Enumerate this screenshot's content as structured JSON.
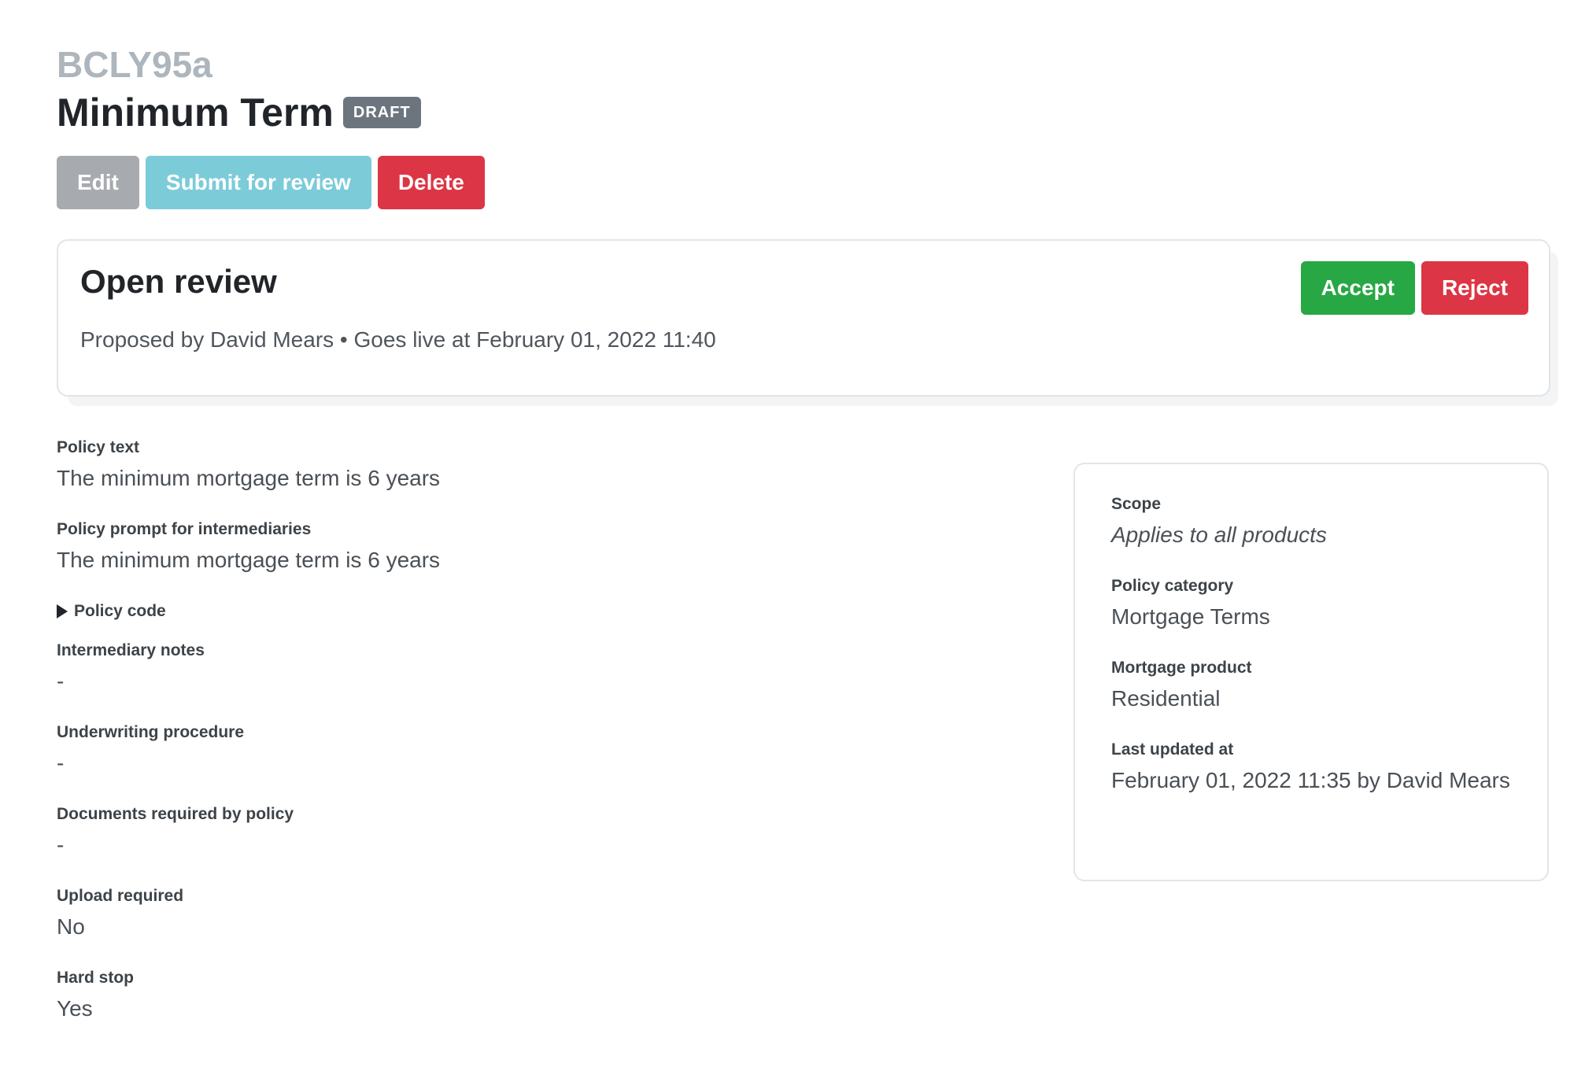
{
  "header": {
    "code": "BCLY95a",
    "title": "Minimum Term",
    "status_badge": "DRAFT"
  },
  "actions": {
    "edit": "Edit",
    "submit_for_review": "Submit for review",
    "delete": "Delete"
  },
  "review": {
    "title": "Open review",
    "meta": "Proposed by David Mears • Goes live at February 01, 2022 11:40",
    "accept": "Accept",
    "reject": "Reject"
  },
  "details": {
    "policy_text": {
      "label": "Policy text",
      "value": "The minimum mortgage term is 6 years"
    },
    "policy_prompt": {
      "label": "Policy prompt for intermediaries",
      "value": "The minimum mortgage term is 6 years"
    },
    "policy_code_summary": "Policy code",
    "intermediary_notes": {
      "label": "Intermediary notes",
      "value": "-"
    },
    "underwriting_procedure": {
      "label": "Underwriting procedure",
      "value": "-"
    },
    "documents_required": {
      "label": "Documents required by policy",
      "value": "-"
    },
    "upload_required": {
      "label": "Upload required",
      "value": "No"
    },
    "hard_stop": {
      "label": "Hard stop",
      "value": "Yes"
    }
  },
  "sidebar": {
    "scope": {
      "label": "Scope",
      "value": "Applies to all products"
    },
    "policy_category": {
      "label": "Policy category",
      "value": "Mortgage Terms"
    },
    "mortgage_product": {
      "label": "Mortgage product",
      "value": "Residential"
    },
    "last_updated": {
      "label": "Last updated at",
      "value": "February 01, 2022 11:35 by David Mears"
    }
  },
  "colors": {
    "badge": "#6c757d",
    "edit": "#a7abaf",
    "submit": "#7ccbd9",
    "danger": "#dc3545",
    "success": "#28a745"
  }
}
